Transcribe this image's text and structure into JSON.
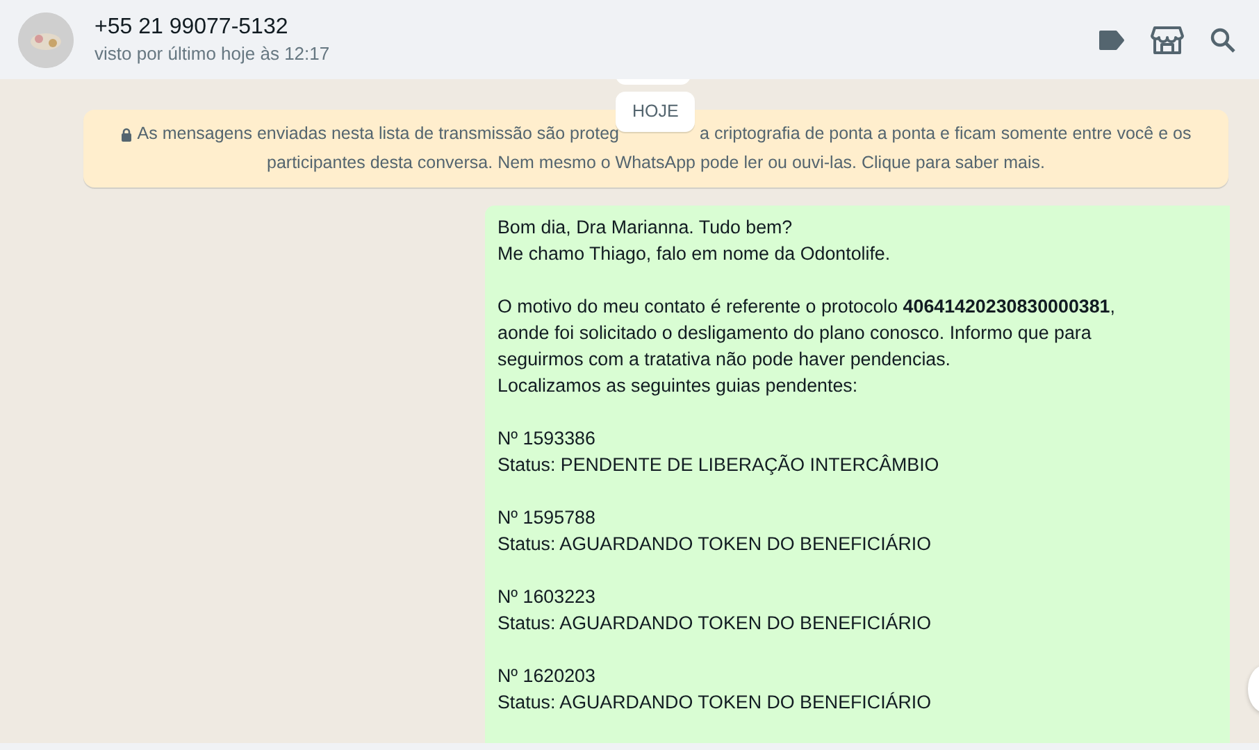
{
  "header": {
    "contact": "+55 21 99077-5132",
    "status": "visto por último hoje às 12:17"
  },
  "date_badge": "HOJE",
  "notice": {
    "line_1_start": "As mensagens enviadas nesta lista de transmissão são proteg",
    "line_1_end": "a criptografia de ponta a ponta e ficam somente entre você e os",
    "line_2": "participantes desta conversa. Nem mesmo o WhatsApp pode ler ou ouvi-las. Clique para saber mais."
  },
  "message": {
    "paragraphs": [
      [
        "Bom dia, Dra Marianna. Tudo bem?",
        "Me chamo Thiago, falo em nome da Odontolife."
      ],
      [
        "O motivo do meu contato é referente o protocolo **40641420230830000381**,",
        "aonde foi solicitado o desligamento do plano conosco. Informo que para",
        "seguirmos com a tratativa não pode haver pendencias.",
        "Localizamos as seguintes guias pendentes:"
      ],
      [
        "Nº 1593386",
        "Status: PENDENTE DE LIBERAÇÃO INTERCÂMBIO"
      ],
      [
        "Nº 1595788",
        "Status: AGUARDANDO TOKEN DO BENEFICIÁRIO"
      ],
      [
        "Nº 1603223",
        "Status: AGUARDANDO TOKEN DO BENEFICIÁRIO"
      ],
      [
        "Nº 1620203",
        "Status: AGUARDANDO TOKEN DO BENEFICIÁRIO"
      ]
    ]
  }
}
